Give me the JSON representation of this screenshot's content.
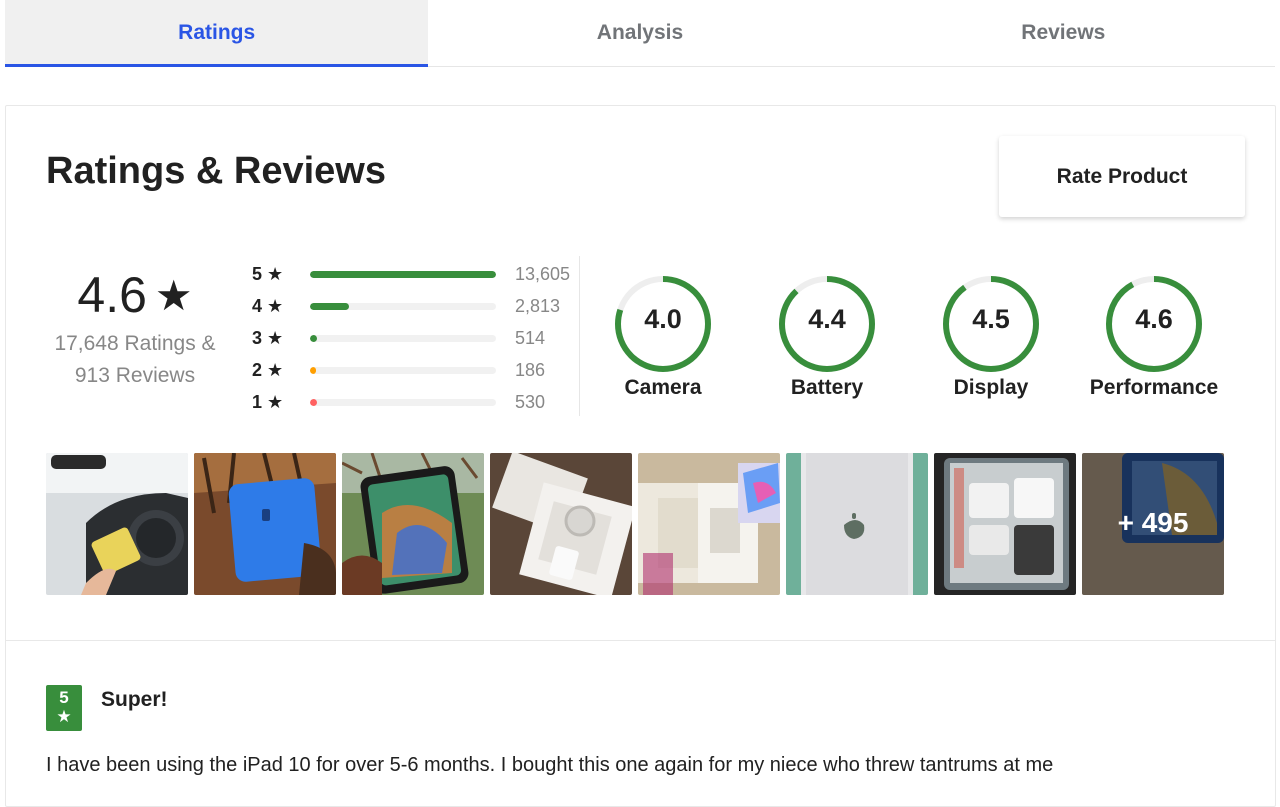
{
  "tabs": [
    {
      "label": "Ratings",
      "active": true
    },
    {
      "label": "Analysis",
      "active": false
    },
    {
      "label": "Reviews",
      "active": false
    }
  ],
  "card": {
    "title": "Ratings & Reviews",
    "rate_button_label": "Rate Product"
  },
  "overall": {
    "rating": "4.6",
    "star": "★",
    "ratings_count_text": "17,648 Ratings &",
    "reviews_count_text": "913 Reviews"
  },
  "distribution": [
    {
      "label": "5 ★",
      "count": "13,605",
      "fraction": 1.0,
      "color": "#388e3c"
    },
    {
      "label": "4 ★",
      "count": "2,813",
      "fraction": 0.21,
      "color": "#388e3c"
    },
    {
      "label": "3 ★",
      "count": "514",
      "fraction": 0.04,
      "color": "#388e3c"
    },
    {
      "label": "2 ★",
      "count": "186",
      "fraction": 0.014,
      "color": "#ff9f00"
    },
    {
      "label": "1 ★",
      "count": "530",
      "fraction": 0.04,
      "color": "#ff6161"
    }
  ],
  "aspects": [
    {
      "name": "Camera",
      "value": "4.0",
      "fraction": 0.8
    },
    {
      "name": "Battery",
      "value": "4.4",
      "fraction": 0.88
    },
    {
      "name": "Display",
      "value": "4.5",
      "fraction": 0.9
    },
    {
      "name": "Performance",
      "value": "4.6",
      "fraction": 0.92
    }
  ],
  "photos": {
    "more_label": "+ 495"
  },
  "review": {
    "rating": "5",
    "star": "★",
    "title": "Super!",
    "text": "I have been using the iPad 10 for over 5-6 months. I bought this one again for my niece who threw tantrums at me"
  },
  "colors": {
    "accent": "#2a55e5",
    "green": "#388e3c",
    "orange": "#ff9f00",
    "red": "#ff6161"
  }
}
